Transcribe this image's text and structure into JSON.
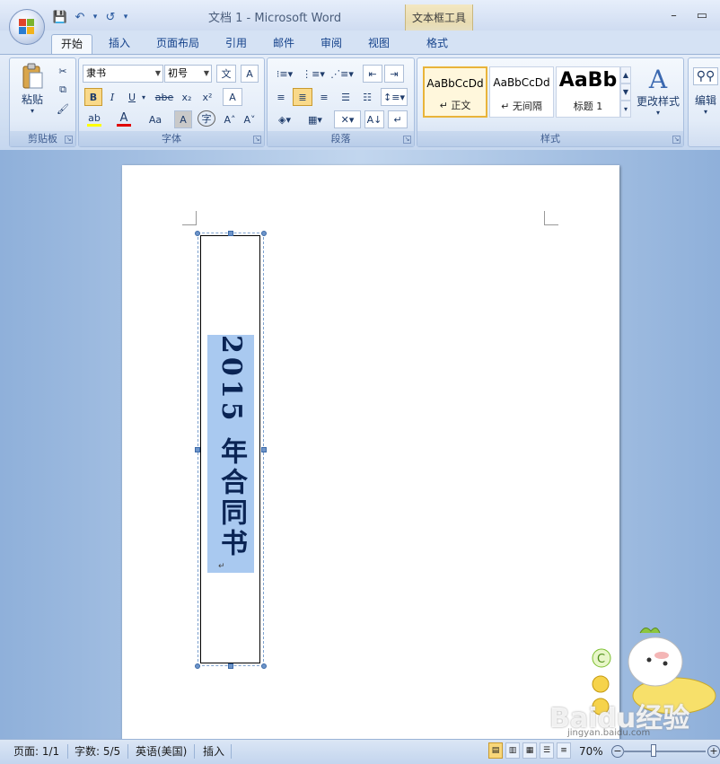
{
  "window": {
    "title": "文档 1 - Microsoft Word",
    "context_tool_label": "文本框工具",
    "minimize": "–",
    "restore": "▭"
  },
  "qat": {
    "save": "💾",
    "undo": "↶",
    "redo": "↺",
    "more": "▾"
  },
  "tabs": [
    "开始",
    "插入",
    "页面布局",
    "引用",
    "邮件",
    "审阅",
    "视图",
    "格式"
  ],
  "active_tab": "开始",
  "ribbon": {
    "clipboard": {
      "label": "剪贴板",
      "paste": "粘贴",
      "paste_dd": "▾"
    },
    "font": {
      "label": "字体",
      "font_name": "隶书",
      "font_size": "初号",
      "bold": "B",
      "italic": "I",
      "underline": "U",
      "strike": "abe",
      "subscript": "x₂",
      "superscript": "x²",
      "phonetic": "文",
      "char_border": "A",
      "clear": "A",
      "grow": "A˄",
      "shrink": "A˅",
      "change_case": "Aa",
      "highlight": "ab",
      "font_color": "A",
      "char_shading": "A",
      "enclose": "字"
    },
    "paragraph": {
      "label": "段落"
    },
    "styles": {
      "label": "样式",
      "items": [
        {
          "sample": "AaBbCcDd",
          "name": "↵ 正文"
        },
        {
          "sample": "AaBbCcDd",
          "name": "↵ 无间隔"
        },
        {
          "sample": "AaBb",
          "name": "标题 1"
        }
      ],
      "change_styles": "更改样式"
    },
    "editing": {
      "label": "编辑"
    }
  },
  "document": {
    "vertical_text": "2015 年合同书",
    "para_mark": "↵"
  },
  "statusbar": {
    "page": "页面: 1/1",
    "words": "字数: 5/5",
    "language": "英语(美国)",
    "mode": "插入",
    "zoom": "70%",
    "zoom_minus": "−",
    "zoom_plus": "+"
  },
  "watermark": {
    "text": "Baidu经验",
    "sub": "jingyan.baidu.com"
  },
  "colors": {
    "accent": "#15428b",
    "text_highlight": "#a9c9f0",
    "text_color": "#0a2454",
    "font_color_bar": "#e00000",
    "highlight_bar": "#ffff00"
  }
}
